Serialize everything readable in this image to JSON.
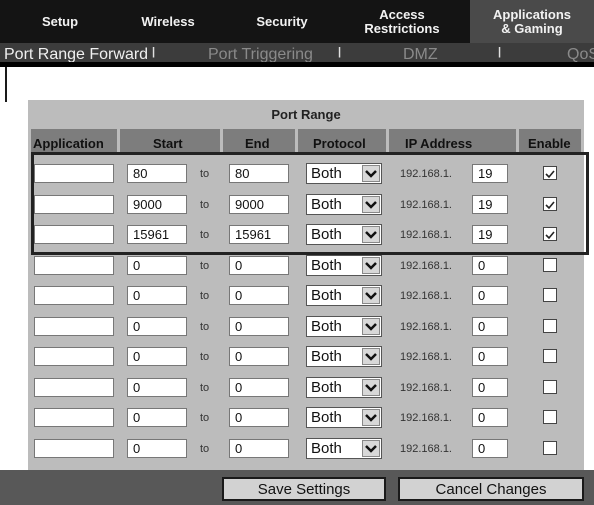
{
  "nav": {
    "tabs": [
      {
        "label": "Setup"
      },
      {
        "label": "Wireless"
      },
      {
        "label": "Security"
      },
      {
        "label": "Access\nRestrictions"
      },
      {
        "label": "Applications\n& Gaming"
      }
    ],
    "subtabs": [
      {
        "label": "Port Range Forward"
      },
      {
        "label": "Port Triggering"
      },
      {
        "label": "DMZ"
      },
      {
        "label": "QoS"
      }
    ],
    "separator": "|"
  },
  "table": {
    "title": "Port Range",
    "headers": {
      "application": "Application",
      "start": "Start",
      "end": "End",
      "protocol": "Protocol",
      "ip": "IP Address",
      "enable": "Enable"
    },
    "to_label": "to",
    "ip_prefix": "192.168.1.",
    "rows": [
      {
        "app": "",
        "start": "80",
        "end": "80",
        "protocol": "Both",
        "ip": "19",
        "enabled": true
      },
      {
        "app": "",
        "start": "9000",
        "end": "9000",
        "protocol": "Both",
        "ip": "19",
        "enabled": true
      },
      {
        "app": "",
        "start": "15961",
        "end": "15961",
        "protocol": "Both",
        "ip": "19",
        "enabled": true
      },
      {
        "app": "",
        "start": "0",
        "end": "0",
        "protocol": "Both",
        "ip": "0",
        "enabled": false
      },
      {
        "app": "",
        "start": "0",
        "end": "0",
        "protocol": "Both",
        "ip": "0",
        "enabled": false
      },
      {
        "app": "",
        "start": "0",
        "end": "0",
        "protocol": "Both",
        "ip": "0",
        "enabled": false
      },
      {
        "app": "",
        "start": "0",
        "end": "0",
        "protocol": "Both",
        "ip": "0",
        "enabled": false
      },
      {
        "app": "",
        "start": "0",
        "end": "0",
        "protocol": "Both",
        "ip": "0",
        "enabled": false
      },
      {
        "app": "",
        "start": "0",
        "end": "0",
        "protocol": "Both",
        "ip": "0",
        "enabled": false
      },
      {
        "app": "",
        "start": "0",
        "end": "0",
        "protocol": "Both",
        "ip": "0",
        "enabled": false
      }
    ]
  },
  "actions": {
    "save": "Save Settings",
    "cancel": "Cancel Changes"
  }
}
